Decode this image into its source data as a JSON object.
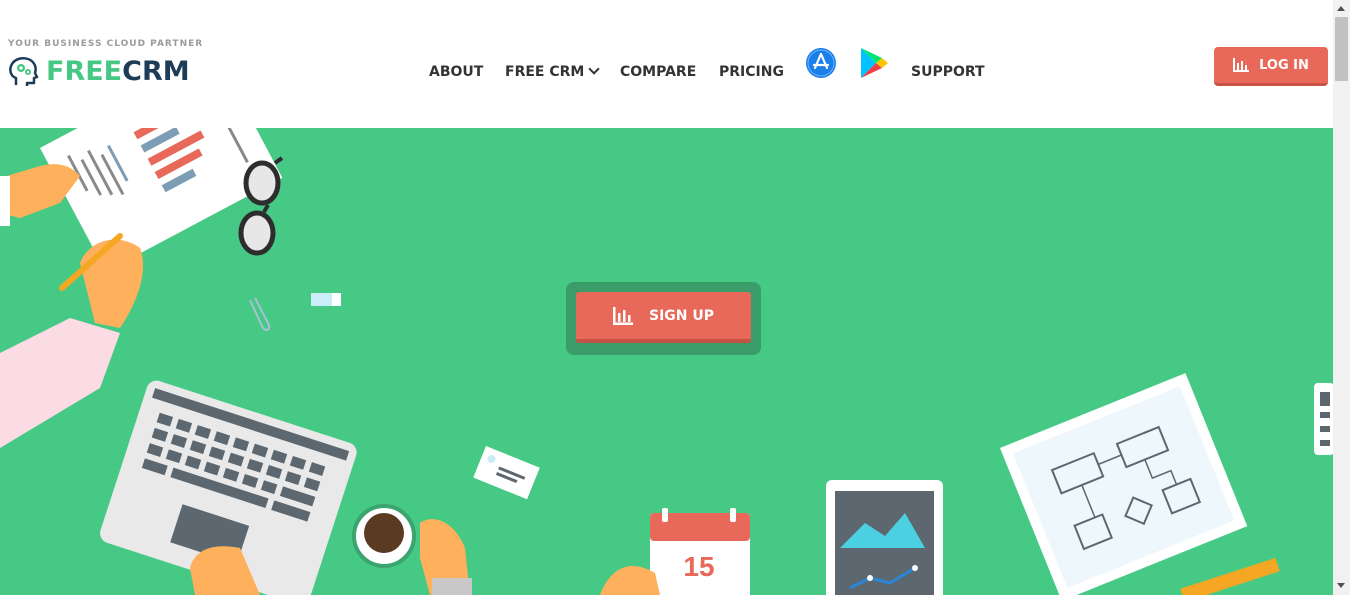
{
  "header": {
    "tagline": "YOUR BUSINESS CLOUD PARTNER",
    "logo": {
      "part1": "FREE",
      "part2": "CRM"
    },
    "nav": [
      {
        "label": "ABOUT"
      },
      {
        "label": "FREE CRM"
      },
      {
        "label": "COMPARE"
      },
      {
        "label": "PRICING"
      },
      {
        "label": "SUPPORT"
      }
    ],
    "store_icons": [
      "app-store-icon",
      "google-play-icon"
    ],
    "login_label": "LOG IN"
  },
  "hero": {
    "signup_label": "SIGN UP",
    "calendar_day": "15"
  },
  "colors": {
    "brand_green": "#46c984",
    "accent_red": "#e8695a",
    "navy": "#1d3c58"
  }
}
